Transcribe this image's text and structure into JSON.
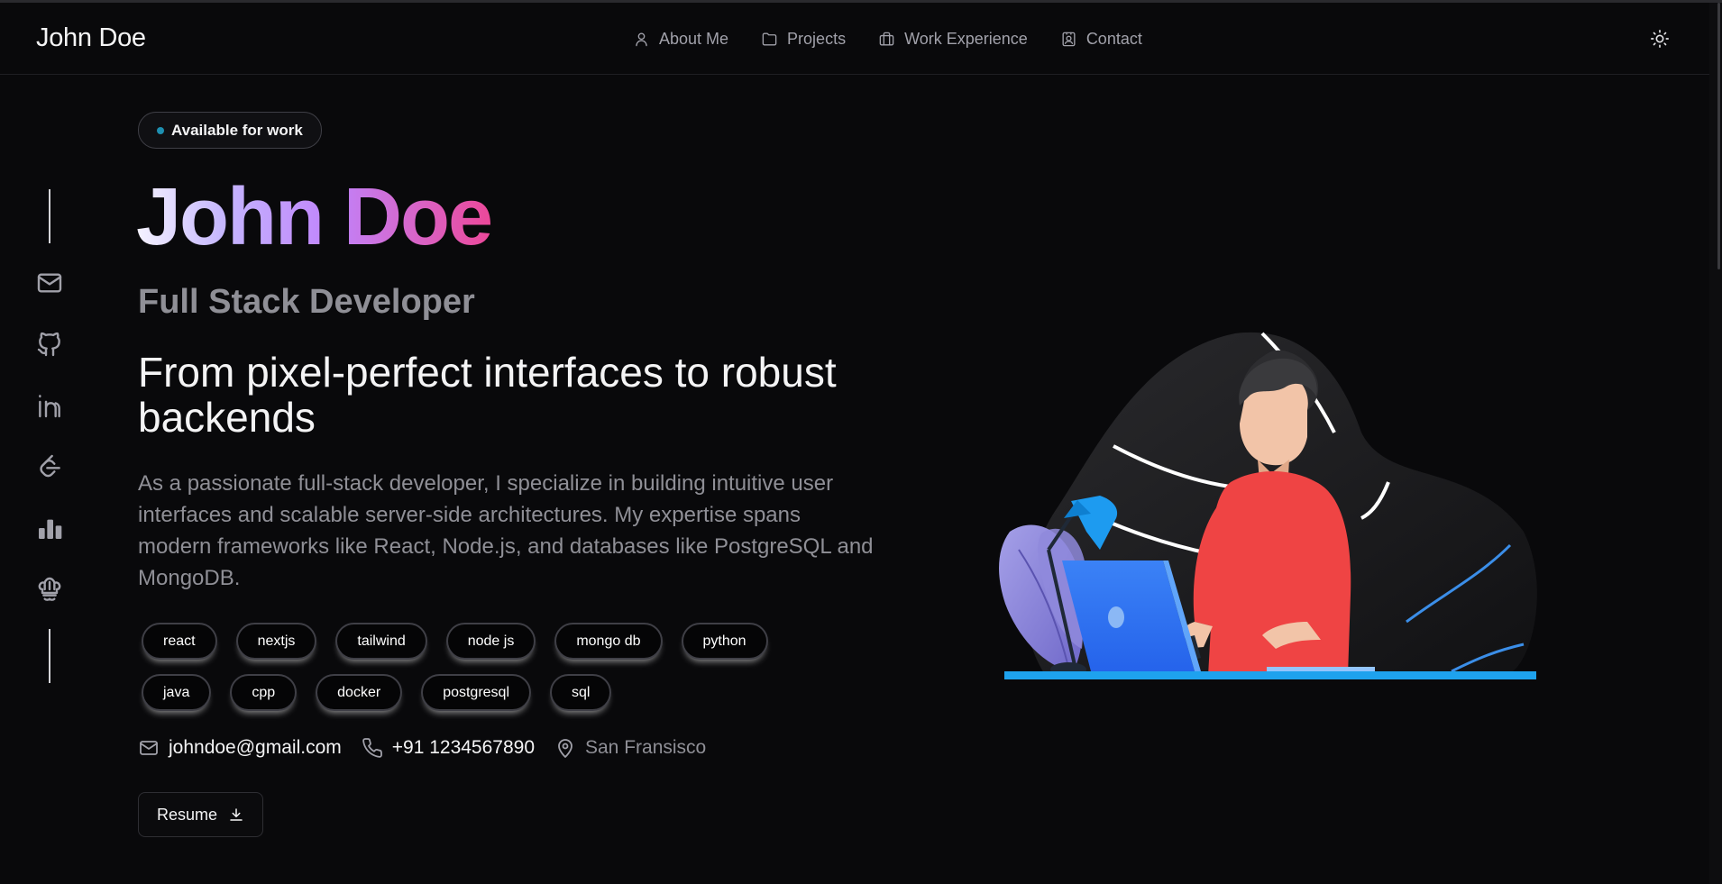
{
  "header": {
    "brand": "John Doe",
    "nav": [
      {
        "label": "About Me",
        "icon": "user-icon"
      },
      {
        "label": "Projects",
        "icon": "folder-icon"
      },
      {
        "label": "Work Experience",
        "icon": "briefcase-icon"
      },
      {
        "label": "Contact",
        "icon": "contact-card-icon"
      }
    ],
    "theme_icon": "sun-icon"
  },
  "sidebar": {
    "icons": [
      "mail-icon",
      "github-icon",
      "linkedin-icon",
      "leetcode-icon",
      "bar-chart-icon",
      "codechef-icon"
    ]
  },
  "hero": {
    "badge": "Available for work",
    "name": "John Doe",
    "role": "Full Stack Developer",
    "headline": "From pixel-perfect interfaces to robust backends",
    "description": "As a passionate full-stack developer, I specialize in building intuitive user interfaces and scalable server-side architectures. My expertise spans modern frameworks like React, Node.js, and databases like PostgreSQL and MongoDB.",
    "skills": [
      "react",
      "nextjs",
      "tailwind",
      "node js",
      "mongo db",
      "python",
      "java",
      "cpp",
      "docker",
      "postgresql",
      "sql"
    ],
    "email": "johndoe@gmail.com",
    "phone": "+91 1234567890",
    "location": "San Fransisco",
    "resume_label": "Resume"
  },
  "colors": {
    "background": "#09090b",
    "name_gradient": [
      "#f5f3ff",
      "#c084fc",
      "#ec4899"
    ],
    "status_dot": "#1e8fb0"
  }
}
